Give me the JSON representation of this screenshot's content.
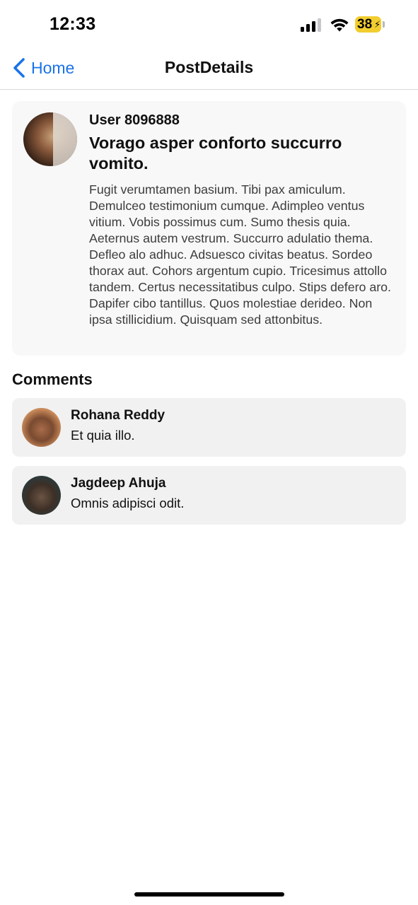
{
  "status_bar": {
    "time": "12:33",
    "battery": "38",
    "battery_color": "#f2cd30",
    "icons": [
      "cellular-signal-icon",
      "wifi-icon",
      "battery-charging-icon"
    ]
  },
  "nav": {
    "back_label": "Home",
    "back_icon": "chevron-left-icon",
    "title": "PostDetails",
    "accent_color": "#1a73e8"
  },
  "post": {
    "user": "User 8096888",
    "title": "Vorago asper conforto succurro vomito.",
    "body": "Fugit verumtamen basium. Tibi pax amiculum. Demulceo testimonium cumque. Adimpleo ventus vitium. Vobis possimus cum. Sumo thesis quia. Aeternus autem vestrum. Succurro adulatio thema. Defleo alo adhuc. Adsuesco civitas beatus. Sordeo thorax aut. Cohors argentum cupio. Tricesimus attollo tandem. Certus necessitatibus culpo. Stips defero aro. Dapifer cibo tantillus. Quos molestiae derideo. Non ipsa stillicidium. Quisquam sed attonbitus."
  },
  "comments": {
    "heading": "Comments",
    "items": [
      {
        "name": "Rohana Reddy",
        "text": "Et quia illo."
      },
      {
        "name": "Jagdeep Ahuja",
        "text": "Omnis adipisci odit."
      }
    ]
  }
}
